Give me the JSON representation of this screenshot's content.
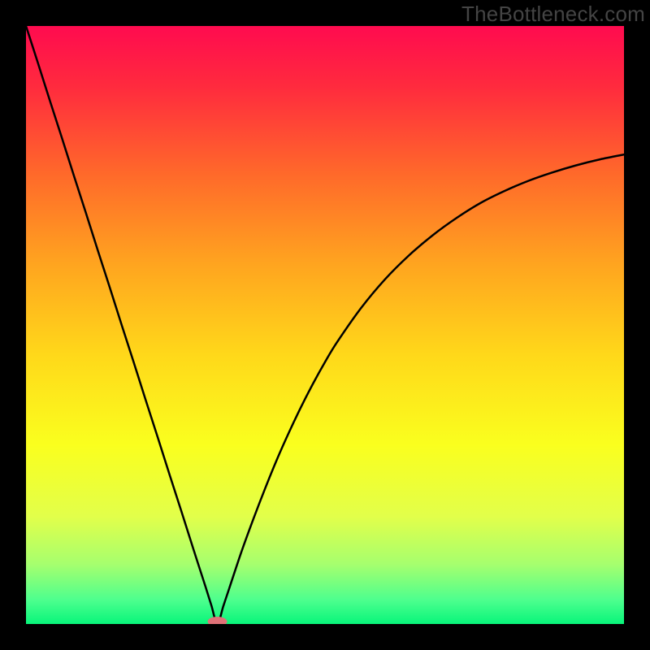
{
  "watermark": "TheBottleneck.com",
  "chart_data": {
    "type": "line",
    "title": "",
    "xlabel": "",
    "ylabel": "",
    "xlim": [
      0,
      100
    ],
    "ylim": [
      0,
      100
    ],
    "x": [
      0,
      2,
      4,
      6,
      8,
      10,
      12,
      14,
      16,
      18,
      20,
      22,
      24,
      26,
      28,
      30,
      31,
      32,
      33,
      34,
      36,
      38,
      40,
      42,
      44,
      46,
      48,
      50,
      52,
      56,
      60,
      64,
      68,
      72,
      76,
      80,
      84,
      88,
      92,
      96,
      100
    ],
    "values": [
      100,
      93.8,
      87.5,
      81.3,
      75,
      68.8,
      62.5,
      56.3,
      50,
      43.8,
      37.5,
      31.3,
      25,
      18.8,
      12.5,
      6.3,
      3.1,
      0,
      3,
      6,
      12,
      17.5,
      22.7,
      27.6,
      32.1,
      36.3,
      40.2,
      43.8,
      47.1,
      52.8,
      57.6,
      61.6,
      65,
      67.9,
      70.4,
      72.4,
      74.1,
      75.5,
      76.7,
      77.7,
      78.5
    ],
    "marker": {
      "x": 32,
      "y": 0
    },
    "gradient_stops": [
      {
        "pos": 0,
        "color": "#ff0b4f"
      },
      {
        "pos": 10,
        "color": "#ff2a3e"
      },
      {
        "pos": 25,
        "color": "#ff6a2a"
      },
      {
        "pos": 40,
        "color": "#ffa51f"
      },
      {
        "pos": 55,
        "color": "#ffd81a"
      },
      {
        "pos": 70,
        "color": "#faff1e"
      },
      {
        "pos": 82,
        "color": "#e2ff4a"
      },
      {
        "pos": 90,
        "color": "#a6ff6e"
      },
      {
        "pos": 96,
        "color": "#4dff8e"
      },
      {
        "pos": 100,
        "color": "#08f57a"
      }
    ],
    "grid": false,
    "legend": false
  }
}
